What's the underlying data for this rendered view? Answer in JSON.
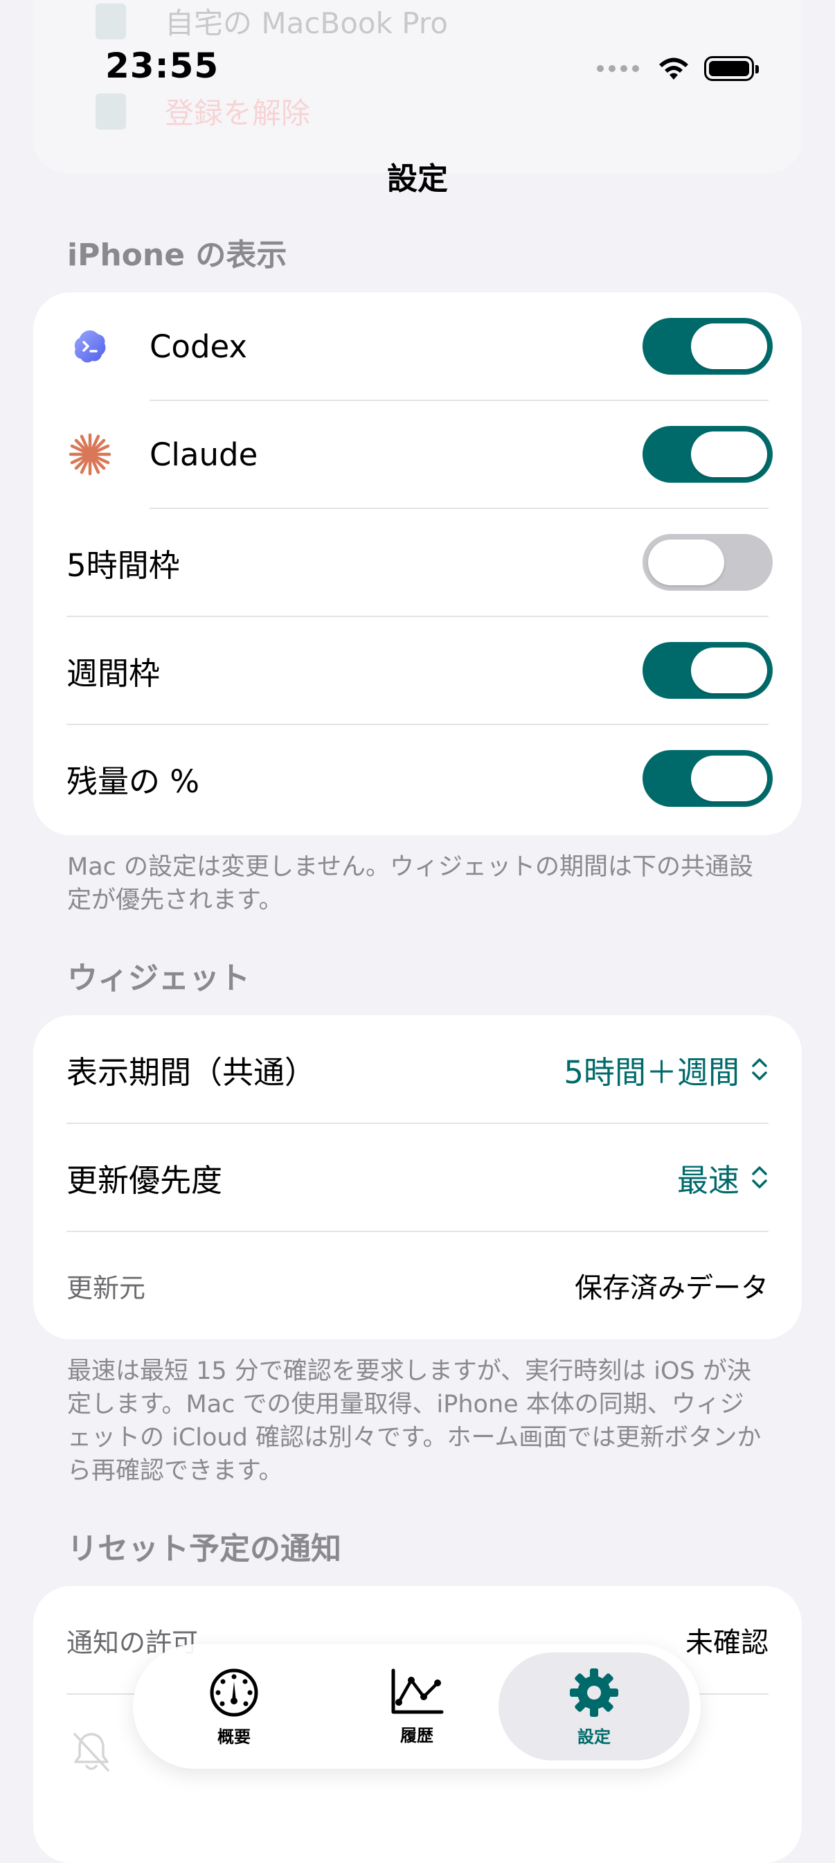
{
  "status": {
    "time": "23:55"
  },
  "ghost": {
    "row1": "自宅の MacBook Pro",
    "row2": "登録を解除"
  },
  "nav": {
    "title": "設定"
  },
  "iphone_display": {
    "header": "iPhone の表示",
    "rows": [
      {
        "label": "Codex",
        "icon": "codex-icon",
        "on": true
      },
      {
        "label": "Claude",
        "icon": "claude-icon",
        "on": true
      },
      {
        "label": "5時間枠",
        "on": false
      },
      {
        "label": "週間枠",
        "on": true
      },
      {
        "label": "残量の %",
        "on": true
      }
    ],
    "footer": "Mac の設定は変更しません。ウィジェットの期間は下の共通設定が優先されます。"
  },
  "widget": {
    "header": "ウィジェット",
    "display_period": {
      "label": "表示期間（共通）",
      "value": "5時間＋週間"
    },
    "update_priority": {
      "label": "更新優先度",
      "value": "最速"
    },
    "update_source": {
      "label": "更新元",
      "value": "保存済みデータ"
    },
    "footer": "最速は最短 15 分で確認を要求しますが、実行時刻は iOS が決定します。Mac での使用量取得、iPhone 本体の同期、ウィジェットの iCloud 確認は別々です。ホーム画面では更新ボタンから再確認できます。"
  },
  "notifications": {
    "header": "リセット予定の通知",
    "permission": {
      "label": "通知の許可",
      "value": "未確認"
    }
  },
  "tabbar": {
    "tabs": [
      {
        "label": "概要",
        "icon": "gauge-icon"
      },
      {
        "label": "履歴",
        "icon": "chart-icon"
      },
      {
        "label": "設定",
        "icon": "gear-icon",
        "selected": true
      }
    ]
  },
  "colors": {
    "accent": "#006a6a",
    "background": "#f2f2f7",
    "claude": "#d97757",
    "codex": "#6b7cf6"
  }
}
